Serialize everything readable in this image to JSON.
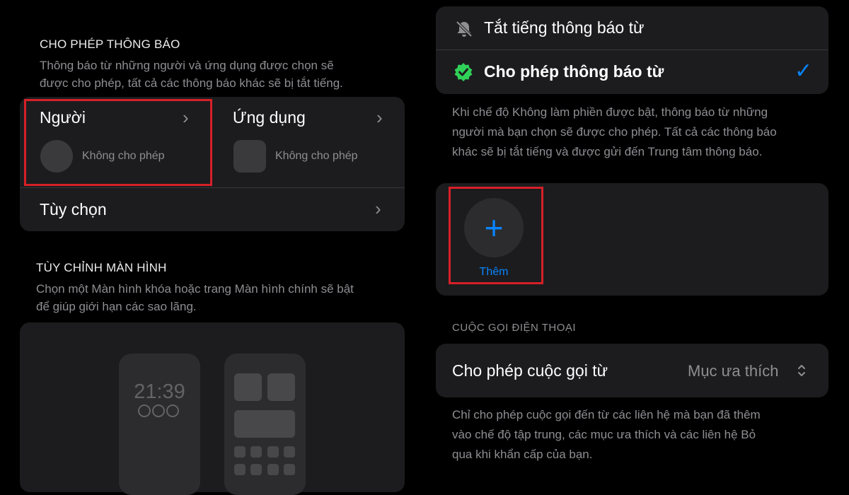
{
  "left": {
    "notifications_section_title": "CHO PHÉP THÔNG BÁO",
    "notifications_desc": [
      "Thông báo từ những người và ứng dụng được chọn sẽ",
      "được cho phép, tất cả các thông báo khác sẽ bị tắt tiếng."
    ],
    "people_label": "Người",
    "people_status": "Không cho phép",
    "apps_label": "Ứng dụng",
    "apps_status": "Không cho phép",
    "options_label": "Tùy chọn",
    "customize_title": "TÙY CHỈNH MÀN HÌNH",
    "customize_desc": [
      "Chọn một Màn hình khóa hoặc trang Màn hình chính sẽ bật",
      "để giúp giới hạn các sao lãng."
    ],
    "lock_time": "21:39"
  },
  "right": {
    "silence_label": "Tắt tiếng thông báo từ",
    "allow_label": "Cho phép thông báo từ",
    "info_desc": [
      "Khi chế độ Không làm phiền được bật, thông báo từ những",
      "người mà bạn chọn sẽ được cho phép. Tất cả các thông báo",
      "khác sẽ bị tắt tiếng và được gửi đến Trung tâm thông báo."
    ],
    "add_label": "Thêm",
    "calls_section_title": "CUỘC GỌI ĐIỆN THOẠI",
    "allow_calls_label": "Cho phép cuộc gọi từ",
    "allow_calls_value": "Mục ưa thích",
    "calls_desc": [
      "Chỉ cho phép cuộc gọi đến từ các liên hệ mà bạn đã thêm",
      "vào chế độ tập trung, các mục ưa thích và các liên hệ Bỏ",
      "qua khi khẩn cấp của bạn."
    ]
  },
  "icons": {
    "chevron": "›",
    "updown": "⌃⌄",
    "check": "✓",
    "plus": "+"
  },
  "colors": {
    "accent": "#0a84ff",
    "highlight": "#d62028",
    "verified": "#30d158"
  }
}
